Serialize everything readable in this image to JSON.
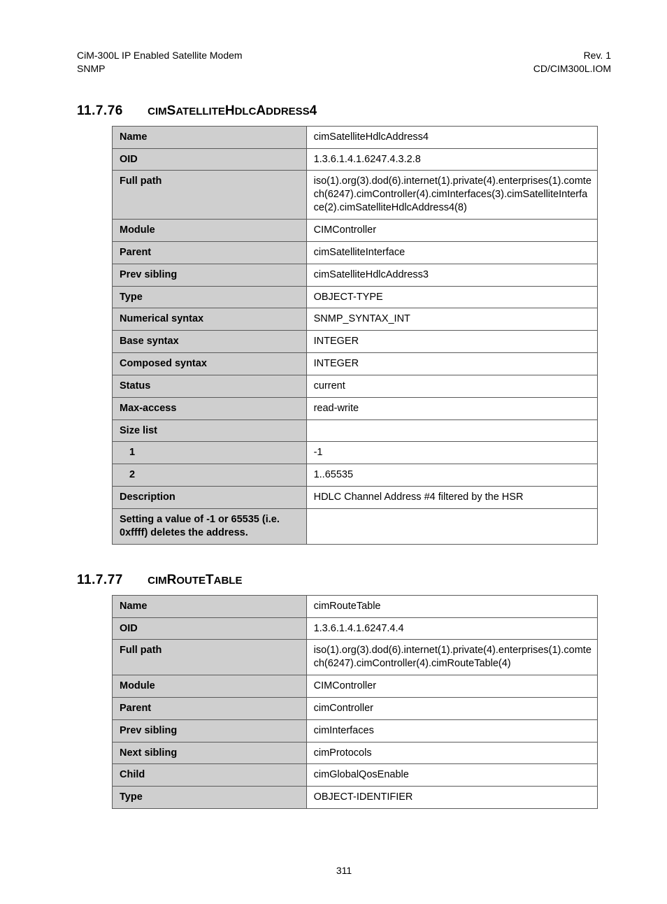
{
  "header": {
    "left1": "CiM-300L IP Enabled Satellite Modem",
    "left2": "SNMP",
    "right1": "Rev. 1",
    "right2": "CD/CIM300L.IOM"
  },
  "section1": {
    "num": "11.7.76",
    "title_pre": "CIM",
    "title_w1a": "S",
    "title_w1b": "ATELLITE",
    "title_w2a": "H",
    "title_w2b": "DLC",
    "title_w3a": "A",
    "title_w3b": "DDRESS",
    "title_suffix": "4",
    "rows": [
      {
        "label": "Name",
        "value": "cimSatelliteHdlcAddress4"
      },
      {
        "label": "OID",
        "value": "1.3.6.1.4.1.6247.4.3.2.8"
      },
      {
        "label": "Full path",
        "value": "iso(1).org(3).dod(6).internet(1).private(4).enterprises(1).comtech(6247).cimController(4).cimInterfaces(3).cimSatelliteInterface(2).cimSatelliteHdlcAddress4(8)"
      },
      {
        "label": "Module",
        "value": "CIMController"
      },
      {
        "label": "Parent",
        "value": "cimSatelliteInterface"
      },
      {
        "label": "Prev sibling",
        "value": "cimSatelliteHdlcAddress3"
      },
      {
        "label": "Type",
        "value": "OBJECT-TYPE"
      },
      {
        "label": "Numerical syntax",
        "value": "SNMP_SYNTAX_INT"
      },
      {
        "label": "Base syntax",
        "value": "INTEGER"
      },
      {
        "label": "Composed syntax",
        "value": "INTEGER"
      },
      {
        "label": "Status",
        "value": "current"
      },
      {
        "label": "Max-access",
        "value": "read-write"
      },
      {
        "label": "Size list",
        "value": ""
      },
      {
        "label": "1",
        "indent": true,
        "value": "-1"
      },
      {
        "label": "2",
        "indent": true,
        "value": "1..65535"
      },
      {
        "label": "Description",
        "value": "HDLC Channel Address #4 filtered by the HSR"
      },
      {
        "label": "Setting a value of -1 or 65535 (i.e. 0xffff) deletes the address.",
        "value": ""
      }
    ]
  },
  "section2": {
    "num": "11.7.77",
    "title_pre": "CIM",
    "title_w1a": "R",
    "title_w1b": "OUTE",
    "title_w2a": "T",
    "title_w2b": "ABLE",
    "rows": [
      {
        "label": "Name",
        "value": "cimRouteTable"
      },
      {
        "label": "OID",
        "value": "1.3.6.1.4.1.6247.4.4"
      },
      {
        "label": "Full path",
        "value": "iso(1).org(3).dod(6).internet(1).private(4).enterprises(1).comtech(6247).cimController(4).cimRouteTable(4)"
      },
      {
        "label": "Module",
        "value": "CIMController"
      },
      {
        "label": "Parent",
        "value": "cimController"
      },
      {
        "label": "Prev sibling",
        "value": "cimInterfaces"
      },
      {
        "label": "Next sibling",
        "value": "cimProtocols"
      },
      {
        "label": "Child",
        "value": "cimGlobalQosEnable"
      },
      {
        "label": "Type",
        "value": "OBJECT-IDENTIFIER"
      }
    ]
  },
  "footer": {
    "page": "311"
  }
}
